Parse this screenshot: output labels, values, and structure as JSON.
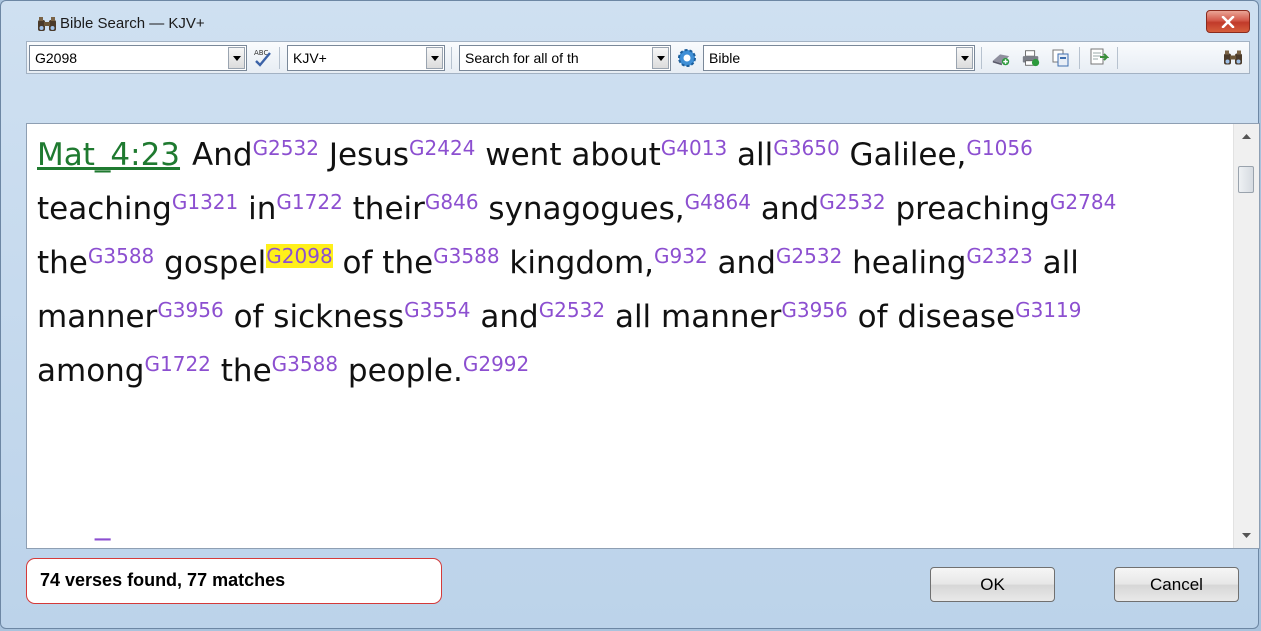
{
  "window": {
    "title": "Bible Search — KJV+",
    "title_icon": "binoculars-icon",
    "close_icon": "close-icon"
  },
  "toolbar": {
    "search_value": "G2098",
    "version_value": "KJV+",
    "mode_value": "Search for all of th",
    "scope_value": "Bible",
    "icons": [
      "spell-check-icon",
      "gear-icon",
      "library-icon",
      "print-icon",
      "copy-icon",
      "export-icon",
      "binoculars-icon"
    ]
  },
  "verse": {
    "reference": "Mat_4:23",
    "tokens": [
      {
        "w": "And",
        "s": "G2532"
      },
      {
        "w": " Jesus",
        "s": "G2424"
      },
      {
        "w": " went about",
        "s": "G4013"
      },
      {
        "w": " all",
        "s": "G3650"
      },
      {
        "w": " Galilee,",
        "s": "G1056"
      },
      {
        "w": " teaching",
        "s": "G1321"
      },
      {
        "w": " in",
        "s": "G1722"
      },
      {
        "w": " their",
        "s": "G846"
      },
      {
        "w": " synagogues,",
        "s": "G4864"
      },
      {
        "w": " and",
        "s": "G2532"
      },
      {
        "w": " preaching",
        "s": "G2784"
      },
      {
        "w": " the",
        "s": "G3588"
      },
      {
        "w": " gospel",
        "s": "G2098",
        "highlight": true
      },
      {
        "w": " of the",
        "s": "G3588"
      },
      {
        "w": " kingdom,",
        "s": "G932"
      },
      {
        "w": " and",
        "s": "G2532"
      },
      {
        "w": " healing",
        "s": "G2323"
      },
      {
        "w": " all manner",
        "s": "G3956"
      },
      {
        "w": " of sickness",
        "s": "G3554"
      },
      {
        "w": " and",
        "s": "G2532"
      },
      {
        "w": " all manner",
        "s": "G3956"
      },
      {
        "w": " of disease",
        "s": "G3119"
      },
      {
        "w": " among",
        "s": "G1722"
      },
      {
        "w": " the",
        "s": "G3588"
      },
      {
        "w": " people.",
        "s": "G2992"
      }
    ],
    "highlight_color": "#fff01a",
    "reference_color": "#1f7a30",
    "strong_color": "#8c4fd0"
  },
  "status": {
    "text": "74 verses found, 77 matches"
  },
  "buttons": {
    "ok": "OK",
    "cancel": "Cancel"
  }
}
